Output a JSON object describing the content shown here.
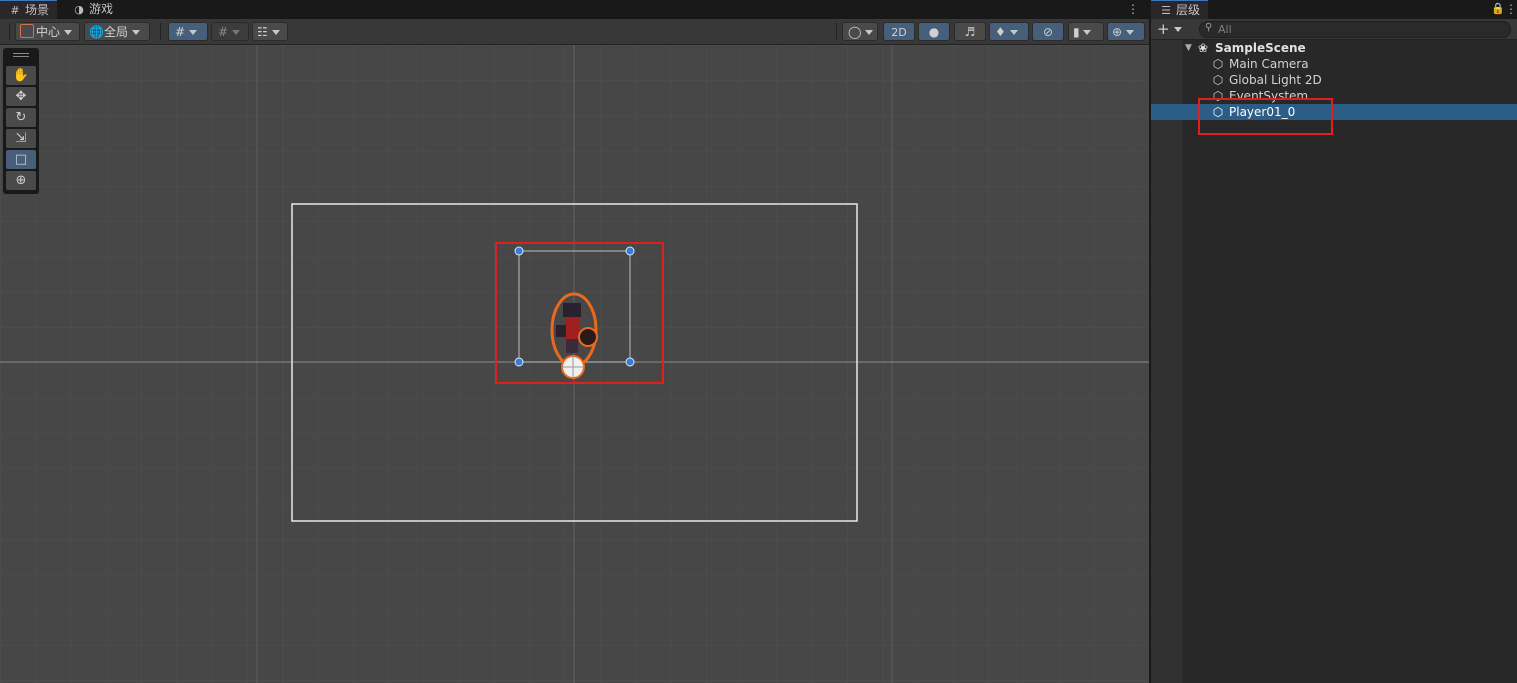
{
  "scene_tabs": [
    {
      "icon": "grid-icon",
      "label": "场景"
    },
    {
      "icon": "gamepad-icon",
      "label": "游戏"
    }
  ],
  "toolbar": {
    "pivot_label": "中心",
    "space_label": "全局",
    "mode_2d_label": "2D"
  },
  "hierarchy": {
    "tab_label": "层级",
    "search_placeholder": "All",
    "scene_name": "SampleScene",
    "items": [
      {
        "label": "Main Camera"
      },
      {
        "label": "Global Light 2D"
      },
      {
        "label": "EventSystem"
      },
      {
        "label": "Player01_0",
        "selected": true
      }
    ]
  },
  "colors": {
    "selection": "#2c5d87",
    "highlight_box": "#e02020",
    "handle": "#3a7bd5"
  }
}
